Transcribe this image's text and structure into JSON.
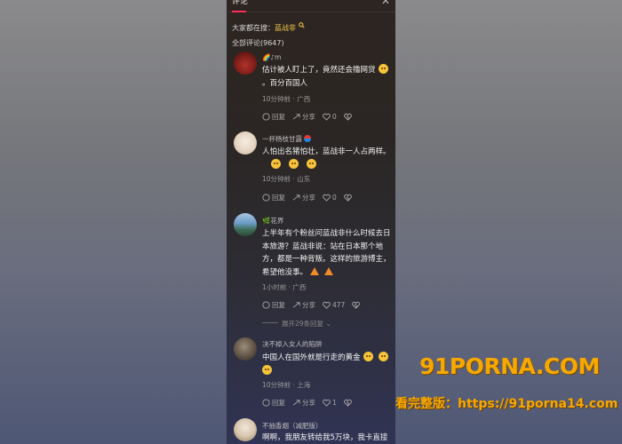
{
  "header": {
    "tab_title": "评论",
    "close_glyph": "✕"
  },
  "search_hint": {
    "prefix": "大家都在搜：",
    "keyword": "蓝战非",
    "icon": "search-icon"
  },
  "comment_count_label": "全部评论(9647)",
  "comments": [
    {
      "username": "🌈♪m",
      "text": "估计被人盯上了，竟然还会撸网贷",
      "text_after_emoji": "。百分百国人",
      "meta": "10分钟前 · 广西",
      "reply_label": "回复",
      "share_label": "分享",
      "likes": "0"
    },
    {
      "username": "一杯杨枝甘露",
      "text": "人怕出名猪怕壮，蓝战非一人占两样。",
      "meta": "10分钟前 · 山东",
      "reply_label": "回复",
      "share_label": "分享",
      "likes": "0"
    },
    {
      "username": "🌿花界",
      "text": "上半年有个粉丝问蓝战非什么时候去日本旅游？蓝战非说：站在日本那个地方，都是一种背叛。这样的旅游博主，希望他没事。",
      "meta": "1小时前 · 广西",
      "reply_label": "回复",
      "share_label": "分享",
      "likes": "477"
    },
    {
      "username": "决不掉入女人的陷阱",
      "text": "中国人在国外就是行走的黄金",
      "meta": "10分钟前 · 上海",
      "reply_label": "回复",
      "share_label": "分享",
      "likes": "1"
    },
    {
      "username": "不抽香烟（减肥版）",
      "text": "啊啊，我朋友转给我5万块，我卡直接"
    }
  ],
  "expand_replies_label": "展开29条回复",
  "watermark": {
    "logo": "91PORNA.COM",
    "text": "看完整版：https://91porna14.com"
  },
  "colors": {
    "accent": "#fe2c55",
    "keyword": "#f3c94a",
    "watermark": "#f7a800"
  }
}
